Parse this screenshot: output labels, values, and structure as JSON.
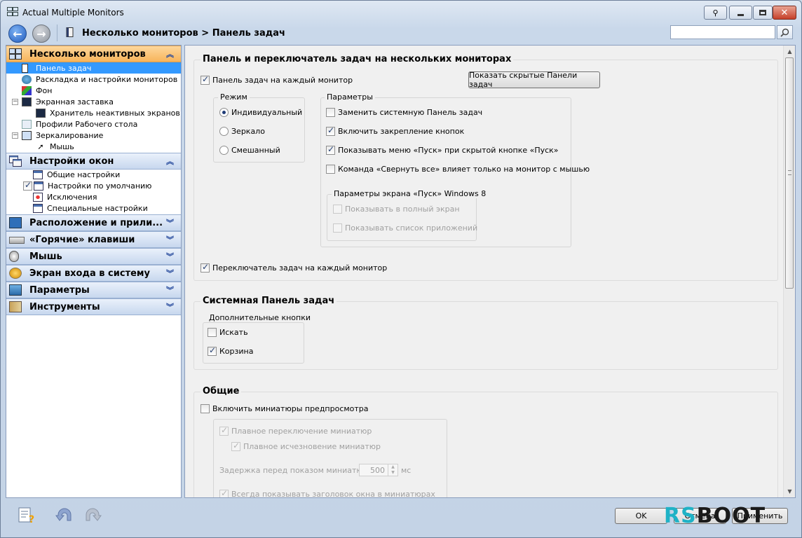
{
  "window": {
    "title": "Actual Multiple Monitors"
  },
  "nav": {
    "breadcrumb": "Несколько мониторов > Панель задач",
    "search_placeholder": ""
  },
  "sidebar": {
    "sections": [
      {
        "label": "Несколько мониторов",
        "expanded": true,
        "items": [
          "Панель задач",
          "Раскладка и настройки мониторов",
          "Фон",
          "Экранная заставка",
          "Хранитель неактивных экранов",
          "Профили Рабочего стола",
          "Зеркалирование",
          "Мышь"
        ]
      },
      {
        "label": "Настройки окон",
        "expanded": true,
        "items": [
          "Общие настройки",
          "Настройки по умолчанию",
          "Исключения",
          "Специальные настройки"
        ]
      },
      {
        "label": "Расположение и прили..."
      },
      {
        "label": "«Горячие» клавиши"
      },
      {
        "label": "Мышь"
      },
      {
        "label": "Экран входа в систему"
      },
      {
        "label": "Параметры"
      },
      {
        "label": "Инструменты"
      }
    ]
  },
  "main": {
    "group1": {
      "title": "Панель и переключатель задач на нескольких мониторах",
      "taskbar_each": {
        "label": "Панель задач на каждый монитор",
        "checked": true
      },
      "show_hidden_button": "Показать скрытые Панели задач",
      "mode": {
        "title": "Режим",
        "options": [
          "Индивидуальный",
          "Зеркало",
          "Смешанный"
        ],
        "selected": 0
      },
      "params": {
        "title": "Параметры",
        "options": [
          {
            "label": "Заменить системную Панель задач",
            "checked": false
          },
          {
            "label": "Включить закрепление кнопок",
            "checked": true
          },
          {
            "label": "Показывать меню «Пуск» при скрытой кнопке «Пуск»",
            "checked": true
          },
          {
            "label": "Команда «Свернуть все» влияет только на монитор с мышью",
            "checked": false
          }
        ],
        "win8": {
          "title": "Параметры экрана «Пуск» Windows 8",
          "options": [
            {
              "label": "Показывать в полный экран",
              "checked": false
            },
            {
              "label": "Показывать список приложений",
              "checked": false
            }
          ]
        }
      },
      "switcher_each": {
        "label": "Переключатель задач на каждый монитор",
        "checked": true
      }
    },
    "group2": {
      "title": "Системная Панель задач",
      "extra": {
        "title": "Дополнительные кнопки",
        "options": [
          {
            "label": "Искать",
            "checked": false
          },
          {
            "label": "Корзина",
            "checked": true
          }
        ]
      }
    },
    "group3": {
      "title": "Общие",
      "thumbs": {
        "label": "Включить миниатюры предпросмотра",
        "checked": false
      },
      "smooth_switch": {
        "label": "Плавное переключение миниатюр",
        "checked": true
      },
      "smooth_fade": {
        "label": "Плавное исчезновение миниатюр",
        "checked": true
      },
      "delay": {
        "label": "Задержка перед показом миниатюры:",
        "value": "500",
        "unit": "мс"
      },
      "always_title": {
        "label": "Всегда показывать заголовок окна в миниатюрах",
        "checked": true
      }
    }
  },
  "footer": {
    "ok": "OK",
    "cancel": "Отмена",
    "apply": "Применить"
  },
  "watermark": {
    "part1": "RS",
    "part2": "BOOT"
  },
  "colors": {
    "accent": "#3399ff",
    "active_section": "#f7b45a",
    "section": "#c7d7ee"
  }
}
